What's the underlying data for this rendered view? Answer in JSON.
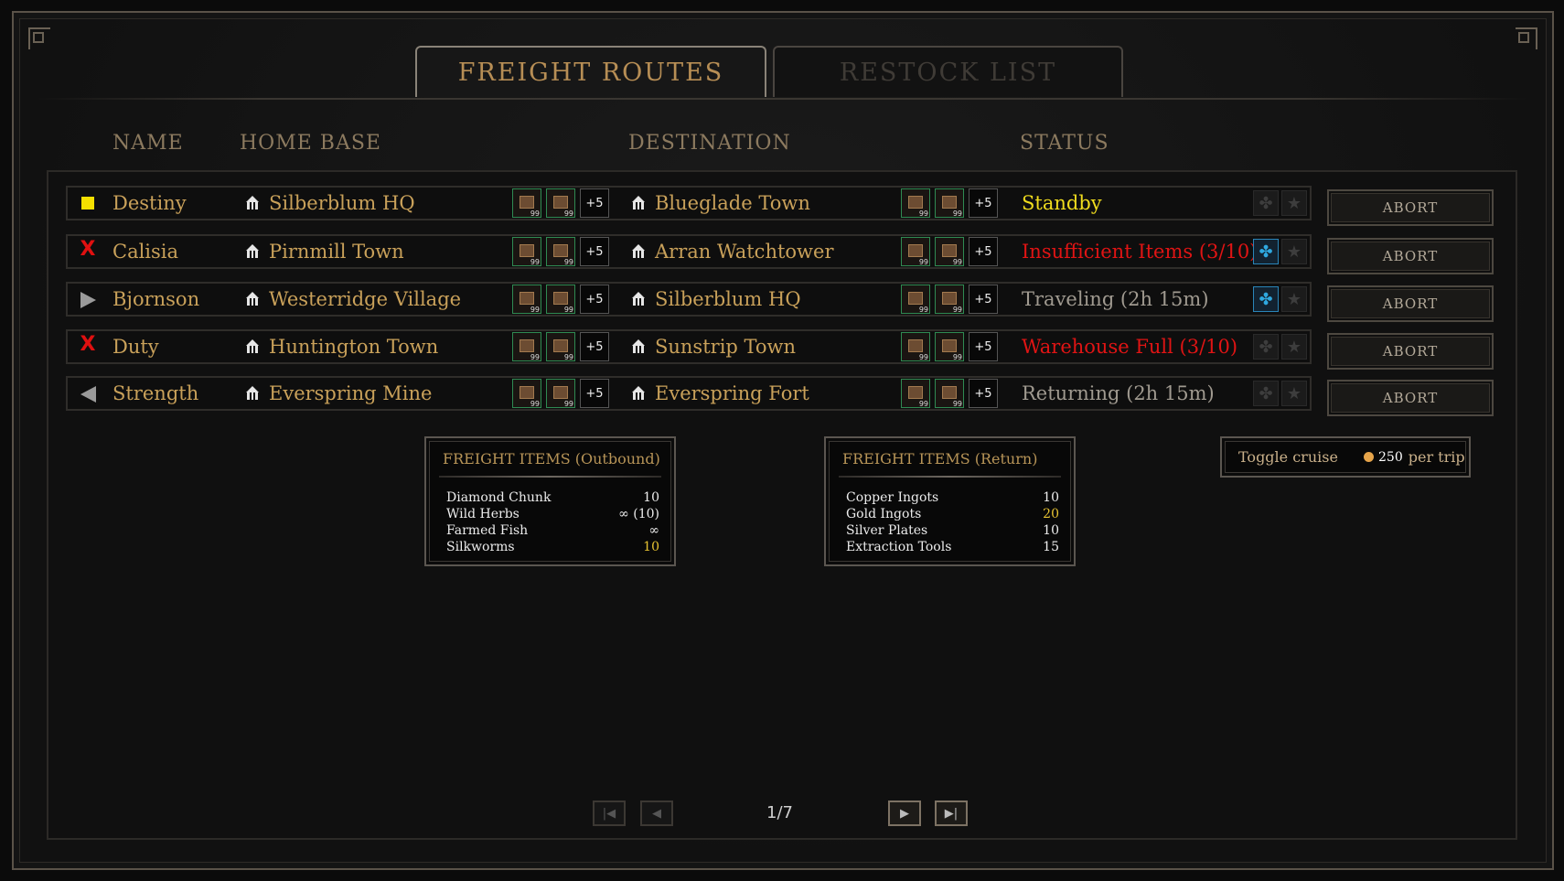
{
  "tabs": [
    {
      "label": "FREIGHT ROUTES",
      "active": true
    },
    {
      "label": "RESTOCK LIST",
      "active": false
    }
  ],
  "headers": {
    "name": "NAME",
    "home_base": "HOME BASE",
    "destination": "DESTINATION",
    "status": "STATUS"
  },
  "colors": {
    "accent": "#c9a15a",
    "error": "#e01414",
    "standby": "#f0dc1e",
    "neutral": "#a09a90",
    "highlight": "#e6c232"
  },
  "routes": [
    {
      "name": "Destiny",
      "marker": "yellow-square-icon",
      "home": "Silberblum HQ",
      "home_item_count": "99",
      "home_more": "+5",
      "destination": "Blueglade Town",
      "dest_item_count": "99",
      "dest_more": "+5",
      "status": "Standby",
      "status_type": "standby",
      "fleet_active": false,
      "starred": false,
      "action": "ABORT"
    },
    {
      "name": "Calisia",
      "marker": "red-x-icon",
      "home": "Pirnmill Town",
      "home_item_count": "99",
      "home_more": "+5",
      "destination": "Arran Watchtower",
      "dest_item_count": "99",
      "dest_more": "+5",
      "status": "Insufficient Items (3/10)",
      "status_type": "error",
      "fleet_active": true,
      "starred": false,
      "action": "ABORT"
    },
    {
      "name": "Bjornson",
      "marker": "arrow-right-icon",
      "home": "Westerridge Village",
      "home_item_count": "99",
      "home_more": "+5",
      "destination": "Silberblum HQ",
      "dest_item_count": "99",
      "dest_more": "+5",
      "status": "Traveling (2h 15m)",
      "status_type": "neutral",
      "fleet_active": true,
      "starred": false,
      "action": "ABORT"
    },
    {
      "name": "Duty",
      "marker": "red-x-icon",
      "home": "Huntington Town",
      "home_item_count": "99",
      "home_more": "+5",
      "destination": "Sunstrip Town",
      "dest_item_count": "99",
      "dest_more": "+5",
      "status": "Warehouse Full (3/10)",
      "status_type": "error",
      "fleet_active": false,
      "starred": false,
      "action": "ABORT"
    },
    {
      "name": "Strength",
      "marker": "arrow-left-icon",
      "home": "Everspring Mine",
      "home_item_count": "99",
      "home_more": "+5",
      "destination": "Everspring Fort",
      "dest_item_count": "99",
      "dest_more": "+5",
      "status": "Returning (2h 15m)",
      "status_type": "neutral",
      "fleet_active": false,
      "starred": false,
      "action": "ABORT"
    }
  ],
  "outbound": {
    "title": "FREIGHT ITEMS (Outbound)",
    "items": [
      {
        "name": "Diamond Chunk",
        "value": "10",
        "highlight": false
      },
      {
        "name": "Wild Herbs",
        "value": "∞ (10)",
        "highlight": false
      },
      {
        "name": "Farmed Fish",
        "value": "∞",
        "highlight": false
      },
      {
        "name": "Silkworms",
        "value": "10",
        "highlight": true
      }
    ]
  },
  "return": {
    "title": "FREIGHT ITEMS (Return)",
    "items": [
      {
        "name": "Copper Ingots",
        "value": "10",
        "highlight": false
      },
      {
        "name": "Gold Ingots",
        "value": "20",
        "highlight": true
      },
      {
        "name": "Silver Plates",
        "value": "10",
        "highlight": false
      },
      {
        "name": "Extraction Tools",
        "value": "15",
        "highlight": false
      }
    ]
  },
  "cruise": {
    "label": "Toggle cruise",
    "cost": "250",
    "unit": "per trip"
  },
  "pagination": {
    "current": "1/7"
  }
}
